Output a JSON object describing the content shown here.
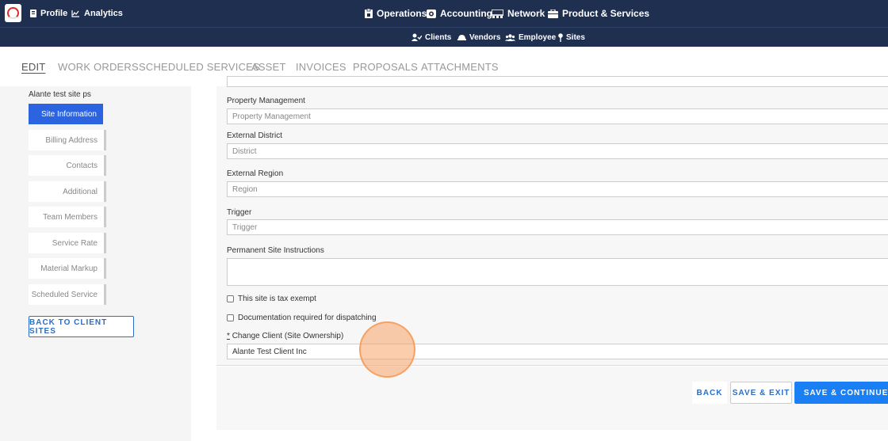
{
  "topnav": {
    "left": [
      {
        "label": "Profile",
        "icon": "id-card-icon"
      },
      {
        "label": "Analytics",
        "icon": "chart-line-icon"
      }
    ],
    "center": [
      {
        "label": "Operations",
        "icon": "clipboard-icon"
      },
      {
        "label": "Accounting",
        "icon": "money-icon"
      },
      {
        "label": "Network",
        "icon": "network-icon"
      },
      {
        "label": "Product & Services",
        "icon": "briefcase-icon"
      }
    ]
  },
  "subnav": [
    {
      "label": "Clients",
      "icon": "user-check-icon"
    },
    {
      "label": "Vendors",
      "icon": "hard-hat-icon"
    },
    {
      "label": "Employee",
      "icon": "users-icon"
    },
    {
      "label": "Sites",
      "icon": "map-pin-icon"
    }
  ],
  "tabs": [
    "EDIT",
    "WORK ORDERS",
    "SCHEDULED SERVICES",
    "ASSET",
    "INVOICES",
    "PROPOSALS",
    "ATTACHMENTS"
  ],
  "sidebar": {
    "site_name": "Alante test site ps",
    "items": [
      "Site Information",
      "Billing Address",
      "Contacts",
      "Additional",
      "Team Members",
      "Service Rate",
      "Material Markup",
      "Scheduled Service"
    ],
    "back_label": "BACK TO CLIENT SITES"
  },
  "form": {
    "property_management": {
      "label": "Property Management",
      "placeholder": "Property Management"
    },
    "external_district": {
      "label": "External District",
      "placeholder": "District"
    },
    "external_region": {
      "label": "External Region",
      "placeholder": "Region"
    },
    "trigger": {
      "label": "Trigger",
      "placeholder": "Trigger"
    },
    "permanent_instructions": {
      "label": "Permanent Site Instructions",
      "value": ""
    },
    "tax_exempt": {
      "label": "This site is tax exempt",
      "checked": false
    },
    "documentation": {
      "label": "Documentation required for dispatching",
      "checked": false
    },
    "change_client": {
      "required_mark": "*",
      "label": "Change Client (Site Ownership)",
      "value": "Alante Test Client Inc"
    }
  },
  "buttons": {
    "back": "BACK",
    "save_exit": "SAVE & EXIT",
    "save_continue": "SAVE & CONTINUE"
  },
  "colors": {
    "nav_bg": "#1e2f4f",
    "accent": "#2b63e0",
    "primary_button": "#1a7ef5",
    "click_highlight": "#f7a468"
  }
}
